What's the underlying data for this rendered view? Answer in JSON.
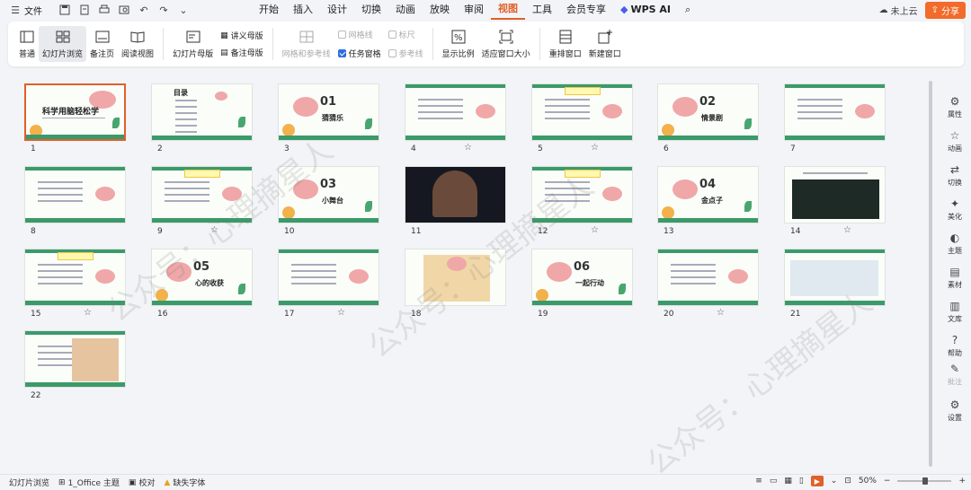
{
  "topbar": {
    "file_label": "文件",
    "tabs": [
      {
        "label": "开始",
        "active": false
      },
      {
        "label": "插入",
        "active": false
      },
      {
        "label": "设计",
        "active": false
      },
      {
        "label": "切换",
        "active": false
      },
      {
        "label": "动画",
        "active": false
      },
      {
        "label": "放映",
        "active": false
      },
      {
        "label": "审阅",
        "active": false
      },
      {
        "label": "视图",
        "active": true
      },
      {
        "label": "工具",
        "active": false
      },
      {
        "label": "会员专享",
        "active": false
      }
    ],
    "wps_ai_label": "WPS AI",
    "cloud_label": "未上云",
    "share_label": "分享",
    "accent_color": "#e0602a"
  },
  "ribbon": {
    "normal": "普通",
    "slide_browse": "幻灯片浏览",
    "notes_page": "备注页",
    "reading_view": "阅读视图",
    "slide_master": "幻灯片母版",
    "handout_master": "讲义母版",
    "notes_master": "备注母版",
    "grid_guides": "网格和参考线",
    "gridlines": "网格线",
    "ruler": "标尺",
    "task_pane": "任务窗格",
    "guides": "参考线",
    "display_ratio": "显示比例",
    "fit_window": "适应窗口大小",
    "arrange_window": "重排窗口",
    "new_window": "新建窗口"
  },
  "slides": [
    {
      "n": "1",
      "title": "科学用脑轻松学",
      "star": false
    },
    {
      "n": "2",
      "title": "目录",
      "star": false
    },
    {
      "n": "3",
      "title": "猜猜乐",
      "num": "01",
      "star": false
    },
    {
      "n": "4",
      "title": "",
      "star": true
    },
    {
      "n": "5",
      "title": "",
      "star": true
    },
    {
      "n": "6",
      "title": "情景剧",
      "num": "02",
      "star": false
    },
    {
      "n": "7",
      "title": "",
      "star": false
    },
    {
      "n": "8",
      "title": "",
      "star": false
    },
    {
      "n": "9",
      "title": "",
      "star": true
    },
    {
      "n": "10",
      "title": "小舞台",
      "num": "03",
      "star": false
    },
    {
      "n": "11",
      "title": "",
      "star": false
    },
    {
      "n": "12",
      "title": "",
      "star": true
    },
    {
      "n": "13",
      "title": "金点子",
      "num": "04",
      "star": false
    },
    {
      "n": "14",
      "title": "",
      "star": true
    },
    {
      "n": "15",
      "title": "",
      "star": true
    },
    {
      "n": "16",
      "title": "心的收获",
      "num": "05",
      "star": false
    },
    {
      "n": "17",
      "title": "",
      "star": true
    },
    {
      "n": "18",
      "title": "",
      "star": false
    },
    {
      "n": "19",
      "title": "一起行动",
      "num": "06",
      "star": false
    },
    {
      "n": "20",
      "title": "",
      "star": true
    },
    {
      "n": "21",
      "title": "",
      "star": false
    },
    {
      "n": "22",
      "title": "",
      "star": false
    }
  ],
  "right_panel": [
    {
      "label": "属性",
      "icon": "sliders-icon"
    },
    {
      "label": "动画",
      "icon": "star-icon"
    },
    {
      "label": "切换",
      "icon": "switch-icon"
    },
    {
      "label": "美化",
      "icon": "magic-icon"
    },
    {
      "label": "主题",
      "icon": "theme-icon"
    },
    {
      "label": "素材",
      "icon": "material-icon"
    },
    {
      "label": "文库",
      "icon": "library-icon"
    },
    {
      "label": "帮助",
      "icon": "help-icon"
    },
    {
      "label": "批注",
      "icon": "comment-icon"
    },
    {
      "label": "设置",
      "icon": "settings-icon"
    }
  ],
  "status": {
    "view_label": "幻灯片浏览",
    "theme_label": "1_Office 主题",
    "proof_label": "校对",
    "missing_font": "缺失字体",
    "zoom": "50%"
  },
  "watermark": "公众号：心理摘星人"
}
